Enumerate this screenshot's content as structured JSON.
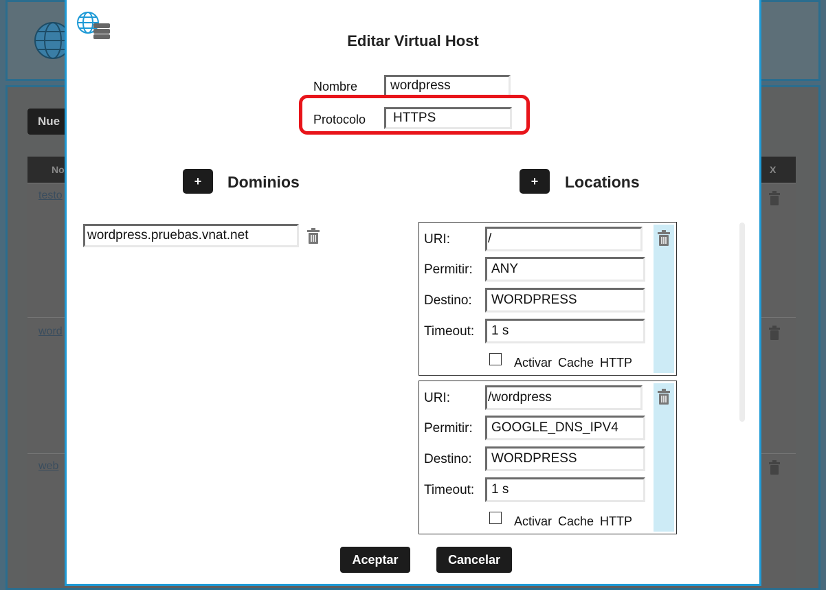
{
  "background": {
    "new_button_label": "Nue",
    "table_header_first": "No",
    "table_header_last": "X",
    "rows": [
      "testo",
      "word",
      "web"
    ]
  },
  "dialog": {
    "title": "Editar Virtual Host",
    "nombre_label": "Nombre",
    "nombre_value": "wordpress",
    "protocolo_label": "Protocolo",
    "protocolo_value": "HTTPS",
    "add_label": "+",
    "dominios_title": "Dominios",
    "locations_title": "Locations",
    "domains": [
      "wordpress.pruebas.vnat.net"
    ],
    "locations": [
      {
        "uri_label": "URI:",
        "uri": "/",
        "permitir_label": "Permitir:",
        "permitir": "ANY",
        "destino_label": "Destino:",
        "destino": "WORDPRESS",
        "timeout_label": "Timeout:",
        "timeout": "1 s",
        "cache_label": "Activar Cache HTTP",
        "cache_checked": false
      },
      {
        "uri_label": "URI:",
        "uri": "/wordpress",
        "permitir_label": "Permitir:",
        "permitir": "GOOGLE_DNS_IPV4",
        "destino_label": "Destino:",
        "destino": "WORDPRESS",
        "timeout_label": "Timeout:",
        "timeout": "1 s",
        "cache_label": "Activar Cache HTTP",
        "cache_checked": false
      }
    ],
    "accept_label": "Aceptar",
    "cancel_label": "Cancelar"
  },
  "colors": {
    "highlight": "#e8141a",
    "modal_border": "#1e9ad6",
    "location_sidebar": "#cdebf6"
  }
}
